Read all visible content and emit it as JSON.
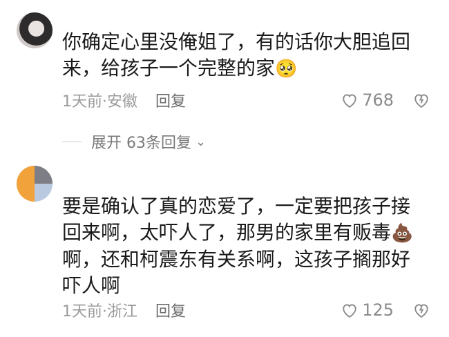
{
  "comments": [
    {
      "text": "你确定心里没俺姐了，有的话你大胆追回来，给孩子一个完整的家",
      "emoji": "🥺",
      "meta_time_loc": "1天前·安徽",
      "reply_label": "回复",
      "likes": "768"
    },
    {
      "text": "要是确认了真的恋爱了，一定要把孩子接回来啊，太吓人了，那男的家里有贩毒",
      "emoji": "💩",
      "text2": "啊，还和柯震东有关系啊，这孩子搁那好吓人啊",
      "meta_time_loc": "1天前·浙江",
      "reply_label": "回复",
      "likes": "125"
    }
  ],
  "expand_label": "展开 63条回复",
  "icons": {
    "heart": "heart-outline-icon",
    "dislike": "dislike-heart-icon",
    "chevron": "chevron-down-icon"
  }
}
